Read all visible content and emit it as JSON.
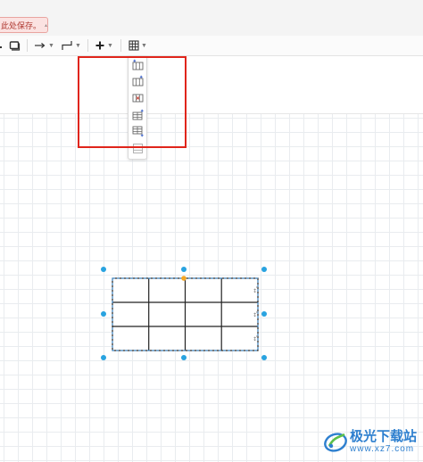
{
  "notice": {
    "text": "此处保存。",
    "icon": "download-icon"
  },
  "toolbar": {
    "items": [
      {
        "name": "waypoint-style",
        "icon": "rectangle-icon"
      },
      {
        "name": "connection-style",
        "icon": "arrow-right-icon"
      },
      {
        "name": "waypoints",
        "icon": "elbow-connector-icon"
      },
      {
        "name": "insert",
        "icon": "plus-icon"
      },
      {
        "name": "table",
        "icon": "table-grid-icon"
      }
    ]
  },
  "table_menu": {
    "items": [
      {
        "icon": "insert-column-before-icon"
      },
      {
        "icon": "insert-column-after-icon"
      },
      {
        "icon": "delete-column-icon"
      },
      {
        "icon": "insert-row-before-icon"
      },
      {
        "icon": "insert-row-after-icon"
      },
      {
        "icon": "delete-row-icon"
      }
    ]
  },
  "shape": {
    "rows": 3,
    "cols": 4,
    "handle_color": "#29a3e0",
    "rotate_handle_color": "#f5a623"
  },
  "colors": {
    "highlight": "#e0251b",
    "notice_bg": "#fbe2e1",
    "notice_text": "#b03a32",
    "watermark": "#2d7fcf"
  },
  "watermark": {
    "name": "极光下载站",
    "url": "www.xz7.com"
  }
}
